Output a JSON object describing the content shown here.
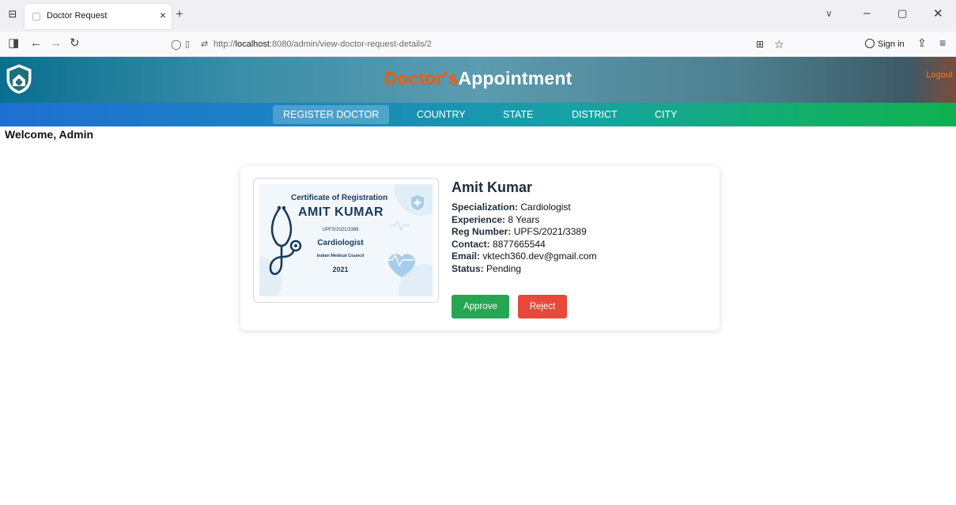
{
  "browser": {
    "tab_title": "Doctor Request",
    "url_prefix": "http://",
    "url_host": "localhost",
    "url_rest": ":8080/admin/view-doctor-request-details/2",
    "sign_in_label": "Sign in"
  },
  "header": {
    "title_part1": "Doctor's",
    "title_part2": "Appointment",
    "logout_label": "Logout"
  },
  "menu": {
    "items": [
      "REGISTER DOCTOR",
      "COUNTRY",
      "STATE",
      "DISTRICT",
      "CITY"
    ],
    "active_index": 0
  },
  "welcome_text": "Welcome, Admin",
  "certificate": {
    "title": "Certificate of Registration",
    "name": "AMIT KUMAR",
    "reg": "UPFS/2021/3389",
    "specialization": "Cardiologist",
    "council": "Indian Medical Council",
    "year": "2021"
  },
  "doctor": {
    "name": "Amit Kumar",
    "fields": [
      {
        "label": "Specialization:",
        "value": "Cardiologist"
      },
      {
        "label": "Experience:",
        "value": "8 Years"
      },
      {
        "label": "Reg Number:",
        "value": "UPFS/2021/3389"
      },
      {
        "label": "Contact:",
        "value": "8877665544"
      },
      {
        "label": "Email:",
        "value": "vktech360.dev@gmail.com"
      },
      {
        "label": "Status:",
        "value": "Pending"
      }
    ]
  },
  "actions": {
    "approve_label": "Approve",
    "reject_label": "Reject"
  },
  "colors": {
    "title_accent": "#f25c05",
    "approve": "#27a552",
    "reject": "#e8493a"
  }
}
